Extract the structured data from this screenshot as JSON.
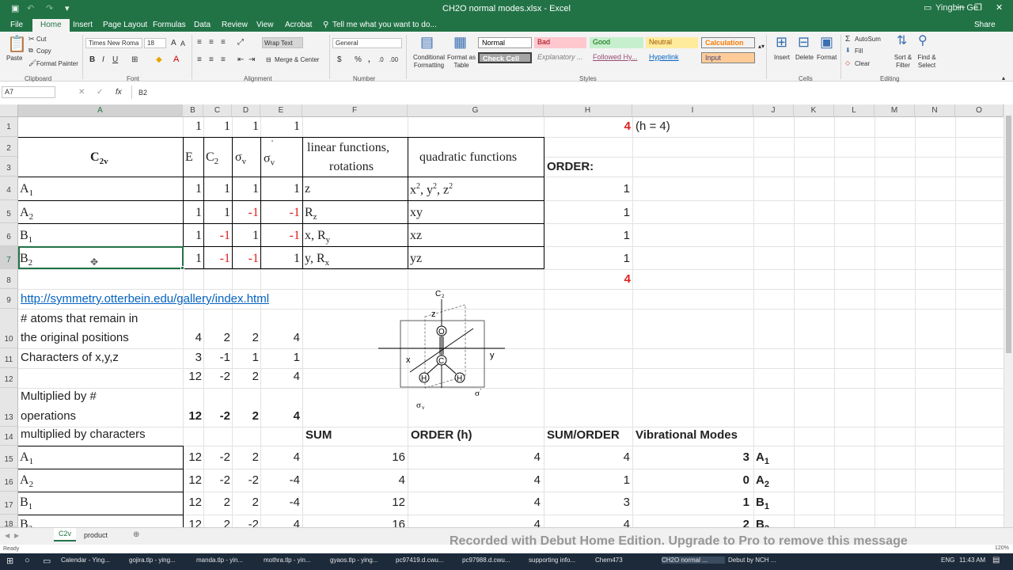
{
  "window": {
    "title": "CH2O normal modes.xlsx - Excel",
    "user": "Yingbin Ge",
    "share": "Share"
  },
  "tabs": [
    "File",
    "Home",
    "Insert",
    "Page Layout",
    "Formulas",
    "Data",
    "Review",
    "View",
    "Acrobat"
  ],
  "tell_me": "Tell me what you want to do...",
  "ribbon": {
    "clipboard": {
      "paste": "Paste",
      "cut": "Cut",
      "copy": "Copy",
      "format_painter": "Format Painter",
      "label": "Clipboard"
    },
    "font": {
      "name": "Times New Roma",
      "size": "18",
      "label": "Font"
    },
    "alignment": {
      "wrap_text": "Wrap Text",
      "merge_center": "Merge & Center",
      "label": "Alignment"
    },
    "number": {
      "format": "General",
      "label": "Number"
    },
    "styles": {
      "conditional": "Conditional Formatting",
      "format_table": "Format as Table",
      "normal": "Normal",
      "bad": "Bad",
      "good": "Good",
      "neutral": "Neutral",
      "calculation": "Calculation",
      "check_cell": "Check Cell",
      "explanatory": "Explanatory ...",
      "followed": "Followed Hy...",
      "hyperlink": "Hyperlink",
      "input": "Input",
      "label": "Styles"
    },
    "cells": {
      "insert": "Insert",
      "delete": "Delete",
      "format": "Format",
      "label": "Cells"
    },
    "editing": {
      "autosum": "AutoSum",
      "fill": "Fill",
      "clear": "Clear",
      "sort": "Sort & Filter",
      "find": "Find & Select",
      "label": "Editing"
    }
  },
  "formula_bar": {
    "name_box": "A7",
    "fx": "fx",
    "content": "B2"
  },
  "columns": [
    "A",
    "B",
    "C",
    "D",
    "E",
    "F",
    "G",
    "H",
    "I",
    "J",
    "K",
    "L",
    "M",
    "N",
    "O"
  ],
  "rows": [
    "1",
    "2",
    "3",
    "4",
    "5",
    "6",
    "7",
    "8",
    "9",
    "10",
    "11",
    "12",
    "13",
    "14",
    "15",
    "16",
    "17",
    "18"
  ],
  "sheet": {
    "r1": {
      "b": "1",
      "c": "1",
      "d": "1",
      "e": "1",
      "h": "4",
      "i": "(h = 4)"
    },
    "header": {
      "group": "C",
      "group_sub": "2v",
      "e": "E",
      "c2": "C",
      "c2_sub": "2",
      "sv": "σ",
      "sv_sub": "v",
      "svp": "σ",
      "svp_sub": "v",
      "svp_sup": "'",
      "linear": "linear functions,",
      "linear2": "rotations",
      "quadratic": "quadratic functions",
      "order": "ORDER:"
    },
    "ct": [
      {
        "l": "A",
        "s": "1",
        "b": "1",
        "c": "1",
        "d": "1",
        "e": "1",
        "f": "z",
        "g": "x",
        "h": "1"
      },
      {
        "l": "A",
        "s": "2",
        "b": "1",
        "c": "1",
        "d": "-1",
        "e": "-1",
        "f": "R",
        "fs": "z",
        "g": "xy",
        "h": "1"
      },
      {
        "l": "B",
        "s": "1",
        "b": "1",
        "c": "-1",
        "d": "1",
        "e": "-1",
        "f": "x, R",
        "fs": "y",
        "g": "xz",
        "h": "1"
      },
      {
        "l": "B",
        "s": "2",
        "b": "1",
        "c": "-1",
        "d": "-1",
        "e": "1",
        "f": "y, R",
        "fs": "x",
        "g": "yz",
        "h": "1"
      }
    ],
    "quad_parts": {
      "x": "x",
      "comma1": ", y",
      "comma2": ", z",
      "sq": "2"
    },
    "r8_h": "4",
    "link": "http://symmetry.otterbein.edu/gallery/index.html",
    "r10a": "# atoms that remain in",
    "r10b": "the original positions",
    "r10": [
      "4",
      "2",
      "2",
      "4"
    ],
    "r11a": "Characters of x,y,z",
    "r11": [
      "3",
      "-1",
      "1",
      "1"
    ],
    "r12": [
      "12",
      "-2",
      "2",
      "4"
    ],
    "r13a": "Multiplied by #",
    "r13b": "operations",
    "r13": [
      "12",
      "-2",
      "2",
      "4"
    ],
    "r14a": "multiplied by characters",
    "r14": {
      "f": "SUM",
      "g": "ORDER (h)",
      "h": "SUM/ORDER",
      "i": "Vibrational Modes"
    },
    "red_rows": [
      {
        "l": "A",
        "s": "1",
        "v": [
          "12",
          "-2",
          "2",
          "4"
        ],
        "sum": "16",
        "order": "4",
        "so": "4",
        "modes": "3",
        "ml": "A",
        "ms": "1"
      },
      {
        "l": "A",
        "s": "2",
        "v": [
          "12",
          "-2",
          "-2",
          "-4"
        ],
        "sum": "4",
        "order": "4",
        "so": "1",
        "modes": "0",
        "ml": "A",
        "ms": "2"
      },
      {
        "l": "B",
        "s": "1",
        "v": [
          "12",
          "2",
          "2",
          "-4"
        ],
        "sum": "12",
        "order": "4",
        "so": "3",
        "modes": "1",
        "ml": "B",
        "ms": "1"
      },
      {
        "l": "B",
        "s": "2",
        "v": [
          "12",
          "2",
          "-2",
          "4"
        ],
        "sum": "16",
        "order": "4",
        "so": "4",
        "modes": "2",
        "ml": "B",
        "ms": "2"
      }
    ]
  },
  "diagram": {
    "c2": "C",
    "c2_sub": "2",
    "z": "z",
    "x": "x",
    "y": "y",
    "o": "O",
    "c": "C",
    "h": "H",
    "sv": "σ",
    "sv_sub": "v",
    "svp": "σ",
    "svp_sup": "'",
    "svp_sub": "v"
  },
  "sheet_tabs": [
    "C2v",
    "product"
  ],
  "status": "Ready",
  "zoom": "120%",
  "watermark": "Recorded with Debut Home Edition. Upgrade to Pro to remove this message",
  "taskbar": {
    "items": [
      "Calendar - Ying...",
      "gojira.tlp - ying...",
      "manda.tlp - yin...",
      "mothra.tlp - yin...",
      "gyaos.tlp - ying...",
      "pc97419.d.cwu...",
      "pc97988.d.cwu...",
      "supporting info...",
      "Chem473",
      "CH2O normal ...",
      "Debut by NCH ..."
    ],
    "lang": "ENG",
    "time": "11:43 AM"
  }
}
